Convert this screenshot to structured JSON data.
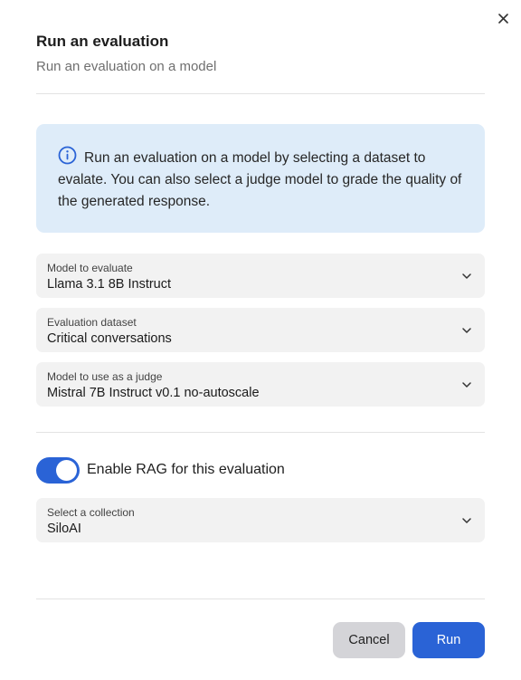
{
  "dialog": {
    "title": "Run an evaluation",
    "subtitle": "Run an evaluation on a model",
    "close_icon": "close-icon"
  },
  "info": {
    "icon": "info-icon",
    "text": "Run an evaluation on a model by selecting a dataset to evalate. You can also select a judge model to grade the quality of the generated response."
  },
  "fields": {
    "model": {
      "label": "Model to evaluate",
      "value": "Llama 3.1 8B Instruct"
    },
    "dataset": {
      "label": "Evaluation dataset",
      "value": "Critical conversations"
    },
    "judge": {
      "label": "Model to use as a judge",
      "value": "Mistral 7B Instruct v0.1 no-autoscale"
    },
    "collection": {
      "label": "Select a collection",
      "value": "SiloAI"
    }
  },
  "rag_toggle": {
    "label": "Enable RAG for this evaluation",
    "enabled": true
  },
  "actions": {
    "cancel_label": "Cancel",
    "run_label": "Run"
  },
  "colors": {
    "accent": "#2a63d6",
    "info_bg": "#deecf9",
    "field_bg": "#f2f2f2",
    "cancel_bg": "#d4d4d8"
  }
}
